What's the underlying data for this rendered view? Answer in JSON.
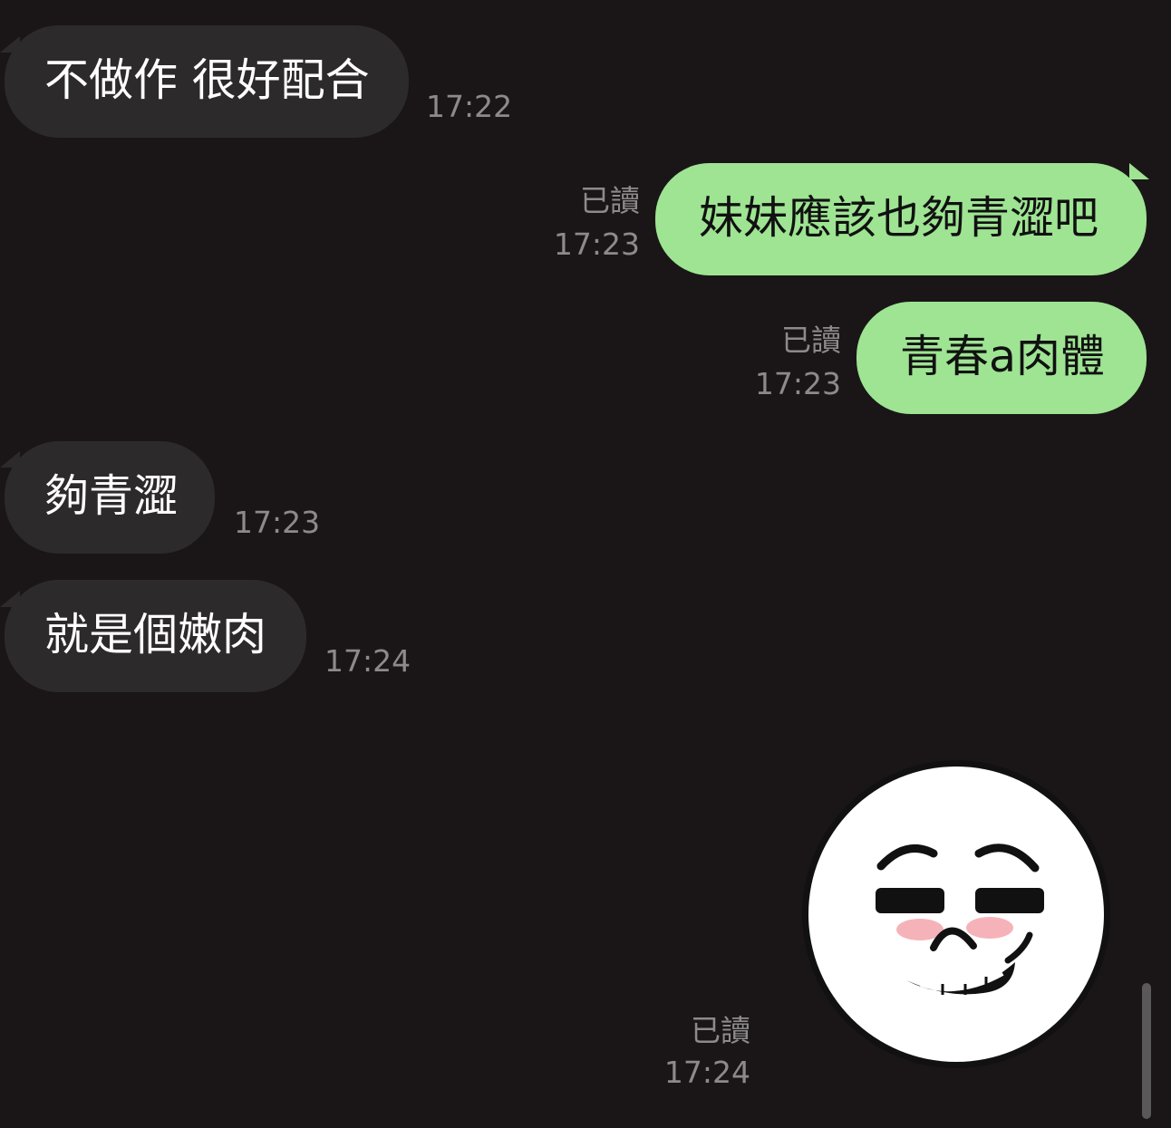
{
  "messages": [
    {
      "side": "incoming",
      "text": "不做作 很好配合",
      "time": "17:22"
    },
    {
      "side": "outgoing",
      "text": "妹妹應該也夠青澀吧",
      "read": "已讀",
      "time": "17:23"
    },
    {
      "side": "outgoing",
      "text": "青春a肉體",
      "read": "已讀",
      "time": "17:23"
    },
    {
      "side": "incoming",
      "text": "夠青澀",
      "time": "17:23"
    },
    {
      "side": "incoming",
      "text": "就是個嫩肉",
      "time": "17:24"
    },
    {
      "side": "outgoing",
      "type": "sticker",
      "sticker_icon": "smirking-face-sticker",
      "read": "已讀",
      "time": "17:24"
    }
  ],
  "colors": {
    "background": "#1a1617",
    "incoming_bubble": "#2d2a2b",
    "outgoing_bubble": "#9ee493",
    "meta_text": "#8d8a8b"
  }
}
